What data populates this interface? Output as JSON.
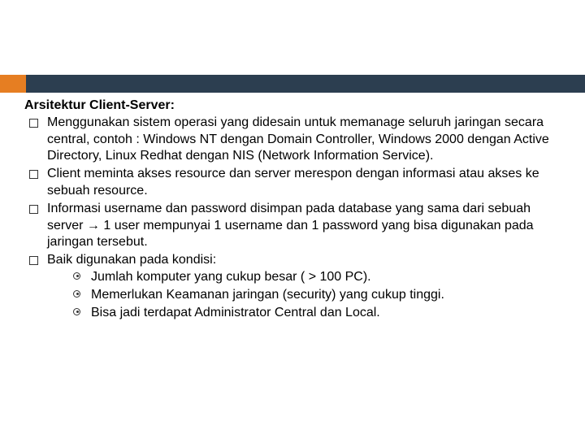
{
  "heading": "Arsitektur Client-Server:",
  "bullets": [
    "Menggunakan sistem  operasi yang didesain untuk memanage seluruh jaringan secara central, contoh : Windows NT dengan Domain Controller, Windows 2000 dengan Active Directory, Linux Redhat dengan NIS (Network Information Service).",
    "Client meminta akses resource dan server merespon dengan informasi atau akses ke sebuah resource.",
    "Informasi username dan password disimpan pada database yang sama dari sebuah server → 1 user mempunyai 1 username dan 1 password yang bisa digunakan pada jaringan tersebut.",
    "Baik digunakan pada kondisi:"
  ],
  "sub_bullets": [
    "Jumlah komputer yang cukup besar ( > 100 PC).",
    "Memerlukan Keamanan jaringan (security) yang cukup tinggi.",
    "Bisa jadi terdapat Administrator Central dan Local."
  ]
}
